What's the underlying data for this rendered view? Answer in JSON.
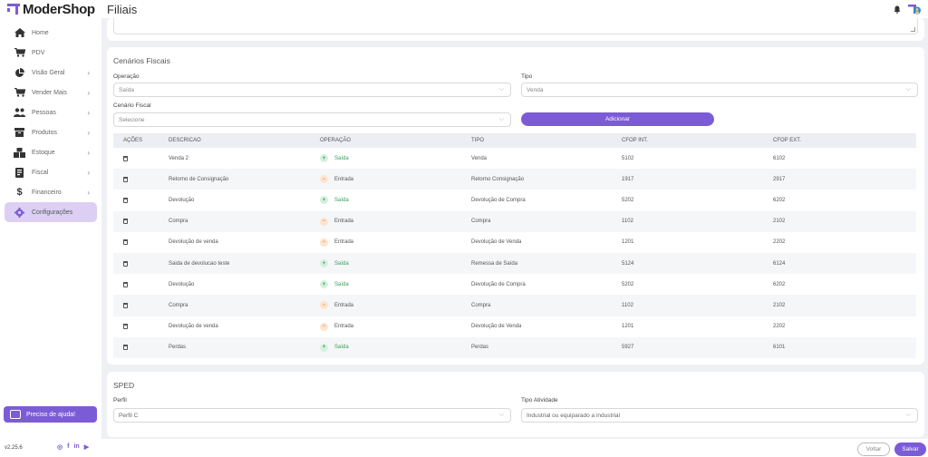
{
  "header": {
    "logo": "ModerShop",
    "page_title": "Filiais"
  },
  "sidebar": {
    "items": [
      {
        "label": "Home",
        "icon": "home-icon",
        "has_chevron": false
      },
      {
        "label": "PDV",
        "icon": "cart-icon",
        "has_chevron": false
      },
      {
        "label": "Visão Geral",
        "icon": "pie-chart-icon",
        "has_chevron": true
      },
      {
        "label": "Vender Mais",
        "icon": "cart-plus-icon",
        "has_chevron": true
      },
      {
        "label": "Pessoas",
        "icon": "people-icon",
        "has_chevron": true
      },
      {
        "label": "Produtos",
        "icon": "box-icon",
        "has_chevron": true
      },
      {
        "label": "Estoque",
        "icon": "boxes-icon",
        "has_chevron": true
      },
      {
        "label": "Fiscal",
        "icon": "document-icon",
        "has_chevron": true
      },
      {
        "label": "Financeiro",
        "icon": "dollar-icon",
        "has_chevron": true
      },
      {
        "label": "Configurações",
        "icon": "gear-icon",
        "has_chevron": false,
        "active": true
      }
    ],
    "help_label": "Preciso de ajuda!",
    "version": "v2.25.6",
    "socials": [
      "instagram-icon",
      "facebook-icon",
      "linkedin-icon",
      "youtube-icon"
    ]
  },
  "fiscal": {
    "title": "Cenários Fiscais",
    "operacao_label": "Operação",
    "operacao_value": "Saída",
    "tipo_label": "Tipo",
    "tipo_value": "Venda",
    "cenario_label": "Cenário Fiscal",
    "cenario_placeholder": "Selecione",
    "add_label": "Adicionar",
    "columns": [
      "AÇÕES",
      "DESCRICAO",
      "OPERAÇÃO",
      "TIPO",
      "CFOP INT.",
      "CFOP EXT."
    ],
    "rows": [
      {
        "descricao": "Venda 2",
        "operacao": "Saída",
        "tipo": "Venda",
        "cfop_int": "5102",
        "cfop_ext": "6102"
      },
      {
        "descricao": "Retorno de Consignação",
        "operacao": "Entrada",
        "tipo": "Retorno Consignação",
        "cfop_int": "1917",
        "cfop_ext": "2917"
      },
      {
        "descricao": "Devolução",
        "operacao": "Saída",
        "tipo": "Devolução de Compra",
        "cfop_int": "5202",
        "cfop_ext": "6202"
      },
      {
        "descricao": "Compra",
        "operacao": "Entrada",
        "tipo": "Compra",
        "cfop_int": "1102",
        "cfop_ext": "2102"
      },
      {
        "descricao": "Devolução de venda",
        "operacao": "Entrada",
        "tipo": "Devolução de Venda",
        "cfop_int": "1201",
        "cfop_ext": "2202"
      },
      {
        "descricao": "Saida de devolucao teste",
        "operacao": "Saída",
        "tipo": "Remessa de Saída",
        "cfop_int": "5124",
        "cfop_ext": "6124"
      },
      {
        "descricao": "Devolução",
        "operacao": "Saída",
        "tipo": "Devolução de Compra",
        "cfop_int": "5202",
        "cfop_ext": "6202"
      },
      {
        "descricao": "Compra",
        "operacao": "Entrada",
        "tipo": "Compra",
        "cfop_int": "1102",
        "cfop_ext": "2102"
      },
      {
        "descricao": "Devolução de venda",
        "operacao": "Entrada",
        "tipo": "Devolução de Venda",
        "cfop_int": "1201",
        "cfop_ext": "2202"
      },
      {
        "descricao": "Perdas",
        "operacao": "Saída",
        "tipo": "Perdas",
        "cfop_int": "5927",
        "cfop_ext": "6101"
      }
    ]
  },
  "sped": {
    "title": "SPED",
    "perfil_label": "Perfil",
    "perfil_value": "Perfil C",
    "tipo_atividade_label": "Tipo Atividade",
    "tipo_atividade_value": "Industrial ou equiparado a industrial"
  },
  "footer": {
    "voltar_label": "Voltar",
    "salvar_label": "Salvar"
  },
  "colors": {
    "accent": "#7c5cd6",
    "active_bg": "#dccff3",
    "saida": "#3a9d5b",
    "entrada": "#e08a3a"
  }
}
